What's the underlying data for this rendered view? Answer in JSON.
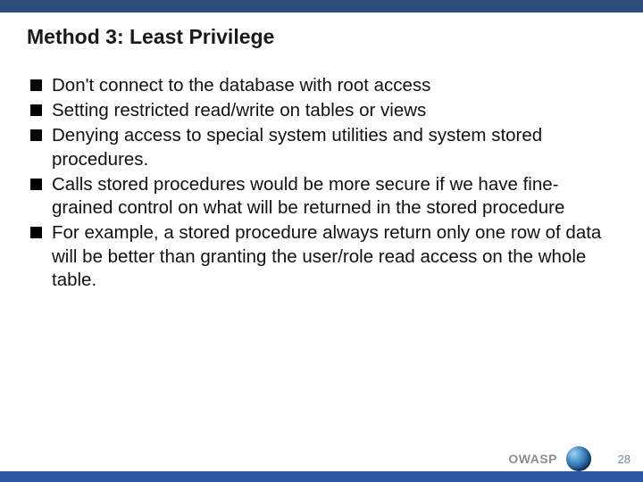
{
  "slide": {
    "title": "Method 3: Least Privilege",
    "bullets": [
      "Don't connect to the database with root access",
      "Setting restricted read/write on tables or views",
      "Denying access to special system utilities and system stored procedures.",
      "Calls stored procedures would be more secure if we have fine-grained control on what will be returned in the stored procedure",
      "For example, a stored procedure always return only one row of data will be  better than granting the user/role read access on the whole table."
    ]
  },
  "footer": {
    "brand": "OWASP",
    "page": "28"
  }
}
